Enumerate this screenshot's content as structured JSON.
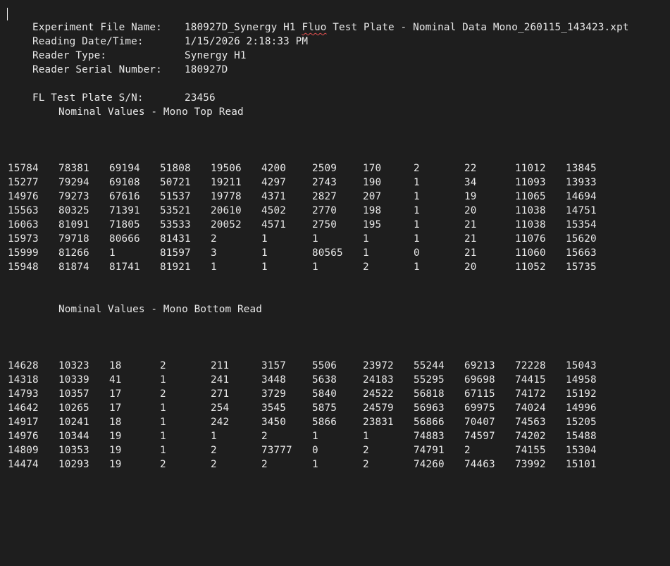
{
  "header": {
    "experiment_label": "Experiment File Name:",
    "experiment_value_a": "180927D_Synergy H1 ",
    "experiment_value_squiggle": "Fluo",
    "experiment_value_b": " Test Plate - Nominal Data Mono_260115_143423.xpt",
    "datetime_label": "Reading Date/Time:",
    "datetime_value": "1/15/2026 2:18:33 PM",
    "reader_type_label": "Reader Type:",
    "reader_type_value": "Synergy H1",
    "serial_label": "Reader Serial Number:",
    "serial_value": "180927D",
    "plate_sn_label": "FL Test Plate S/N:",
    "plate_sn_value": "23456"
  },
  "sections": [
    {
      "heading": "Nominal Values - Mono Top Read",
      "rows": [
        [
          "15784",
          "78381",
          "69194",
          "51808",
          "19506",
          "4200",
          "2509",
          "170",
          "2",
          "22",
          "11012",
          "13845"
        ],
        [
          "15277",
          "79294",
          "69108",
          "50721",
          "19211",
          "4297",
          "2743",
          "190",
          "1",
          "34",
          "11093",
          "13933"
        ],
        [
          "14976",
          "79273",
          "67616",
          "51537",
          "19778",
          "4371",
          "2827",
          "207",
          "1",
          "19",
          "11065",
          "14694"
        ],
        [
          "15563",
          "80325",
          "71391",
          "53521",
          "20610",
          "4502",
          "2770",
          "198",
          "1",
          "20",
          "11038",
          "14751"
        ],
        [
          "16063",
          "81091",
          "71805",
          "53533",
          "20052",
          "4571",
          "2750",
          "195",
          "1",
          "21",
          "11038",
          "15354"
        ],
        [
          "15973",
          "79718",
          "80666",
          "81431",
          "2",
          "1",
          "1",
          "1",
          "1",
          "21",
          "11076",
          "15620"
        ],
        [
          "15999",
          "81266",
          "1",
          "81597",
          "3",
          "1",
          "80565",
          "1",
          "0",
          "21",
          "11060",
          "15663"
        ],
        [
          "15948",
          "81874",
          "81741",
          "81921",
          "1",
          "1",
          "1",
          "2",
          "1",
          "20",
          "11052",
          "15735"
        ]
      ]
    },
    {
      "heading": "Nominal Values - Mono Bottom Read",
      "rows": [
        [
          "14628",
          "10323",
          "18",
          "2",
          "211",
          "3157",
          "5506",
          "23972",
          "55244",
          "69213",
          "72228",
          "15043"
        ],
        [
          "14318",
          "10339",
          "41",
          "1",
          "241",
          "3448",
          "5638",
          "24183",
          "55295",
          "69698",
          "74415",
          "14958"
        ],
        [
          "14793",
          "10357",
          "17",
          "2",
          "271",
          "3729",
          "5840",
          "24522",
          "56818",
          "67115",
          "74172",
          "15192"
        ],
        [
          "14642",
          "10265",
          "17",
          "1",
          "254",
          "3545",
          "5875",
          "24579",
          "56963",
          "69975",
          "74024",
          "14996"
        ],
        [
          "14917",
          "10241",
          "18",
          "1",
          "242",
          "3450",
          "5866",
          "23831",
          "56866",
          "70407",
          "74563",
          "15205"
        ],
        [
          "14976",
          "10344",
          "19",
          "1",
          "1",
          "2",
          "1",
          "1",
          "74883",
          "74597",
          "74202",
          "15488"
        ],
        [
          "14809",
          "10353",
          "19",
          "1",
          "2",
          "73777",
          "0",
          "2",
          "74791",
          "2",
          "74155",
          "15304"
        ],
        [
          "14474",
          "10293",
          "19",
          "2",
          "2",
          "2",
          "1",
          "2",
          "74260",
          "74463",
          "73992",
          "15101"
        ]
      ]
    }
  ],
  "colors": {
    "background": "#1e1e1e",
    "text": "#e8e8e8",
    "spellcheck_underline": "#e05050"
  }
}
